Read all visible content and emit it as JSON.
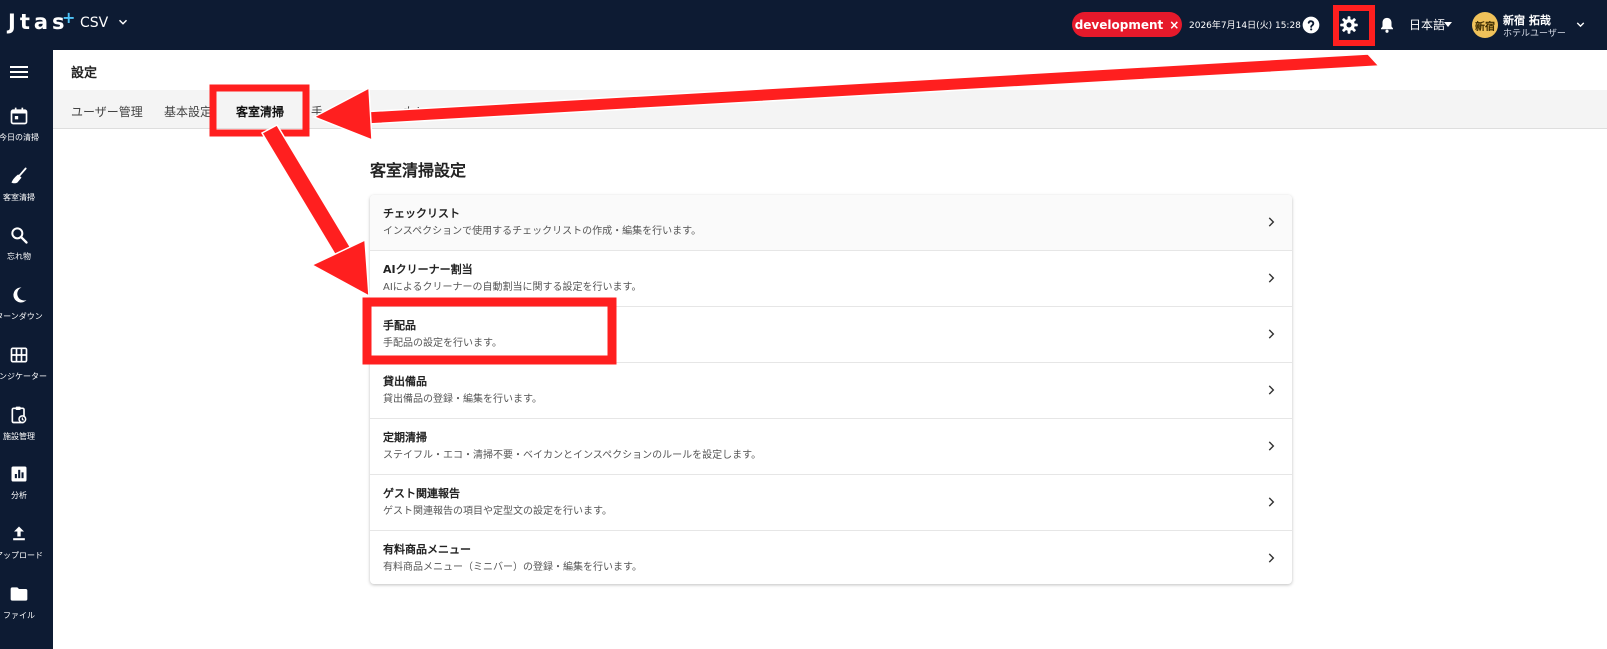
{
  "topbar": {
    "logo": "Jtas",
    "logo_mark": "+",
    "tenant": "CSV",
    "env_badge": "development",
    "env_close": "×",
    "datetime": "2026年7月14日(火) 15:28",
    "language": "日本語",
    "avatar_text": "新宿",
    "user_name": "新宿 拓哉",
    "user_role": "ホテルユーザー"
  },
  "sidebar": {
    "items": [
      {
        "label": "今日の清掃",
        "icon": "calendar-icon"
      },
      {
        "label": "客室清掃",
        "icon": "broom-icon"
      },
      {
        "label": "忘れ物",
        "icon": "search-icon"
      },
      {
        "label": "ターンダウン",
        "icon": "moon-icon"
      },
      {
        "label": "インジケーター",
        "icon": "grid-icon"
      },
      {
        "label": "施設管理",
        "icon": "clipboard-icon"
      },
      {
        "label": "分析",
        "icon": "chart-icon"
      },
      {
        "label": "アップロード",
        "icon": "upload-icon"
      },
      {
        "label": "ファイル",
        "icon": "folder-icon"
      }
    ]
  },
  "page": {
    "title": "設定",
    "tabs": [
      {
        "label": "ユーザー管理"
      },
      {
        "label": "基本設定"
      },
      {
        "label": "客室清掃"
      },
      {
        "label": "手"
      },
      {
        "label": "カレ"
      }
    ],
    "active_tab": "客室清掃",
    "section_title": "客室清掃設定",
    "rows": [
      {
        "title": "チェックリスト",
        "desc": "インスペクションで使用するチェックリストの作成・編集を行います。"
      },
      {
        "title": "AIクリーナー割当",
        "desc": "AIによるクリーナーの自動割当に関する設定を行います。"
      },
      {
        "title": "手配品",
        "desc": "手配品の設定を行います。"
      },
      {
        "title": "貸出備品",
        "desc": "貸出備品の登録・編集を行います。"
      },
      {
        "title": "定期清掃",
        "desc": "ステイフル・エコ・清掃不要・ベイカンとインスペクションのルールを設定します。"
      },
      {
        "title": "ゲスト関連報告",
        "desc": "ゲスト関連報告の項目や定型文の設定を行います。"
      },
      {
        "title": "有料商品メニュー",
        "desc": "有料商品メニュー（ミニバー）の登録・編集を行います。"
      }
    ]
  },
  "colors": {
    "topbar_bg": "#0d1b33",
    "env_badge": "#e6192b",
    "annotation": "#ff1f1f"
  }
}
